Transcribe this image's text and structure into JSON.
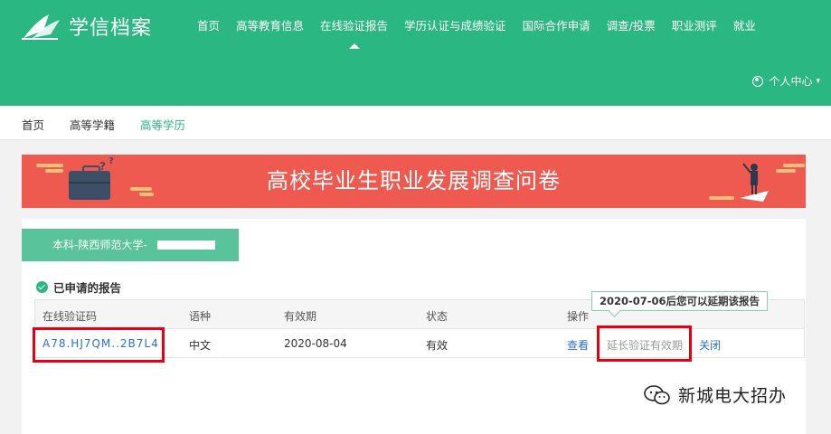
{
  "header": {
    "logo_text": "学信档案",
    "nav": [
      {
        "label": "首页"
      },
      {
        "label": "高等教育信息"
      },
      {
        "label": "在线验证报告",
        "active": true
      },
      {
        "label": "学历认证与成绩验证"
      },
      {
        "label": "国际合作申请"
      },
      {
        "label": "调查/投票"
      },
      {
        "label": "职业测评"
      },
      {
        "label": "就业"
      }
    ],
    "user_center": "个人中心"
  },
  "subnav": [
    {
      "label": "首页"
    },
    {
      "label": "高等学籍"
    },
    {
      "label": "高等学历",
      "current": true
    }
  ],
  "banner": {
    "title": "高校毕业生职业发展调查问卷"
  },
  "degree_tab": {
    "label": "本科-陕西师范大学-"
  },
  "section_title": "已申请的报告",
  "table": {
    "headers": [
      "在线验证码",
      "语种",
      "有效期",
      "状态",
      "操作"
    ],
    "rows": [
      {
        "code": "A78.HJ7QM..2B7L4",
        "language": "中文",
        "expiry": "2020-08-04",
        "status": "有效",
        "view": "查看",
        "extend": "延长验证有效期",
        "close": "关闭"
      }
    ]
  },
  "tooltip": "2020-07-06后您可以延期该报告",
  "watermark": "新城电大招办",
  "colors": {
    "brand_green": "#2bb781",
    "banner_red": "#ee5a50",
    "link_blue": "#2a6fd1",
    "highlight_red": "#e60012"
  }
}
